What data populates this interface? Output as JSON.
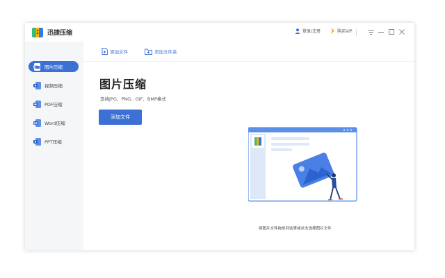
{
  "app": {
    "title": "迅捷压缩"
  },
  "header": {
    "login_label": "登录/注册",
    "vip_label": "购买VIP"
  },
  "sidebar": {
    "items": [
      {
        "label": "图片压缩",
        "icon": "image-file-icon",
        "active": true
      },
      {
        "label": "视频压缩",
        "icon": "video-file-icon",
        "active": false
      },
      {
        "label": "PDF压缩",
        "icon": "pdf-file-icon",
        "active": false
      },
      {
        "label": "Word压缩",
        "icon": "word-file-icon",
        "active": false
      },
      {
        "label": "PPT压缩",
        "icon": "ppt-file-icon",
        "active": false
      }
    ]
  },
  "toolbar": {
    "add_file_label": "添加文件",
    "add_folder_label": "添加文件夹"
  },
  "main": {
    "title": "图片压缩",
    "formats": "支持JPG、PNG、GIF、BMP格式",
    "add_button_label": "添加文件",
    "drop_hint": "将图片文件拖放到这里或点击选择图片文件"
  },
  "colors": {
    "accent": "#3d70d4",
    "sidebar_bg": "#f5f6f8",
    "illustration_blue": "#5b8fe8"
  }
}
